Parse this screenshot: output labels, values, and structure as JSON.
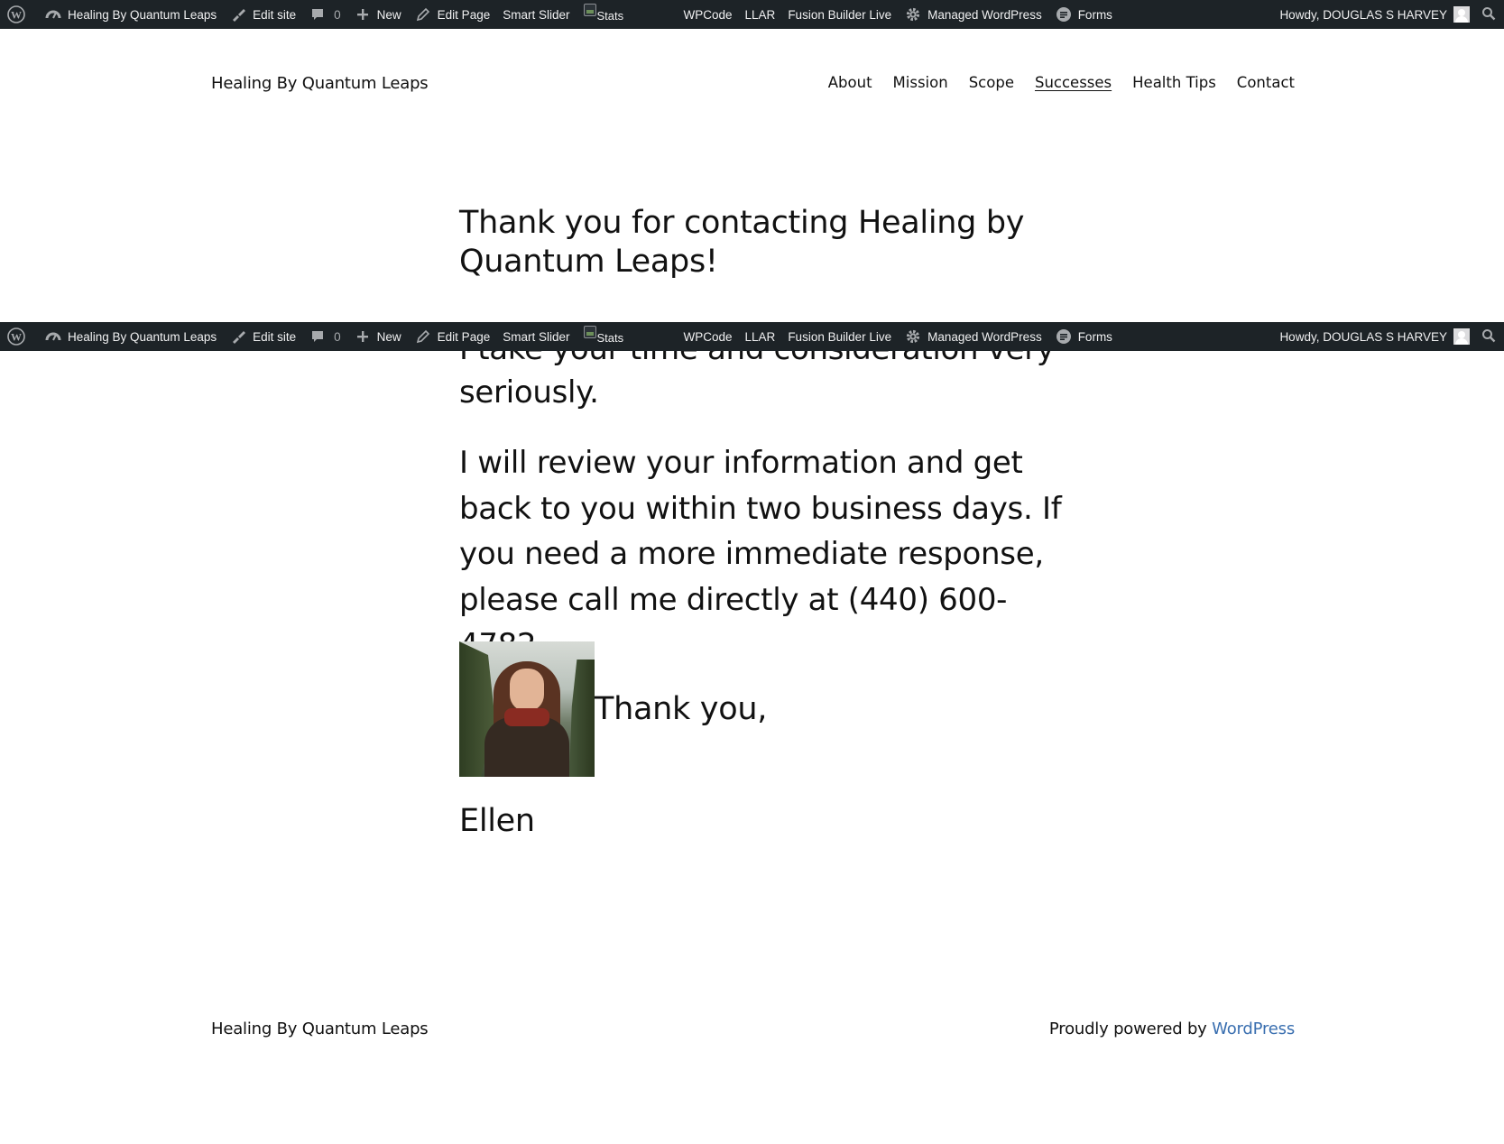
{
  "admin_bar": {
    "site_name": "Healing By Quantum Leaps",
    "edit_site": "Edit site",
    "comments_count": "0",
    "new": "New",
    "edit_page": "Edit Page",
    "smart_slider": "Smart Slider",
    "stats_alt": "Stats",
    "wpcode": "WPCode",
    "llar": "LLAR",
    "fusion_builder": "Fusion Builder Live",
    "managed_wordpress": "Managed WordPress",
    "forms": "Forms",
    "howdy": "Howdy, DOUGLAS S HARVEY"
  },
  "header": {
    "site_title": "Healing By Quantum Leaps",
    "nav": [
      "About",
      "Mission",
      "Scope",
      "Successes",
      "Health Tips",
      "Contact"
    ],
    "active_nav": "Successes"
  },
  "content": {
    "heading": "Thank you for contacting Healing by Quantum Leaps!",
    "fragment": "I take your time and consideration very",
    "paragraph1_end": "seriously.",
    "paragraph2": "I will review your information and get back to you within two business days. If you need a more immediate response, please call me directly at (440) 600-4782.",
    "thanks": "Thank you,",
    "signature": "Ellen"
  },
  "footer": {
    "site_title": "Healing By Quantum Leaps",
    "powered_prefix": "Proudly powered by ",
    "powered_link": "WordPress"
  },
  "colors": {
    "admin_bar_bg": "#1d2327",
    "link": "#3a6fb0"
  }
}
